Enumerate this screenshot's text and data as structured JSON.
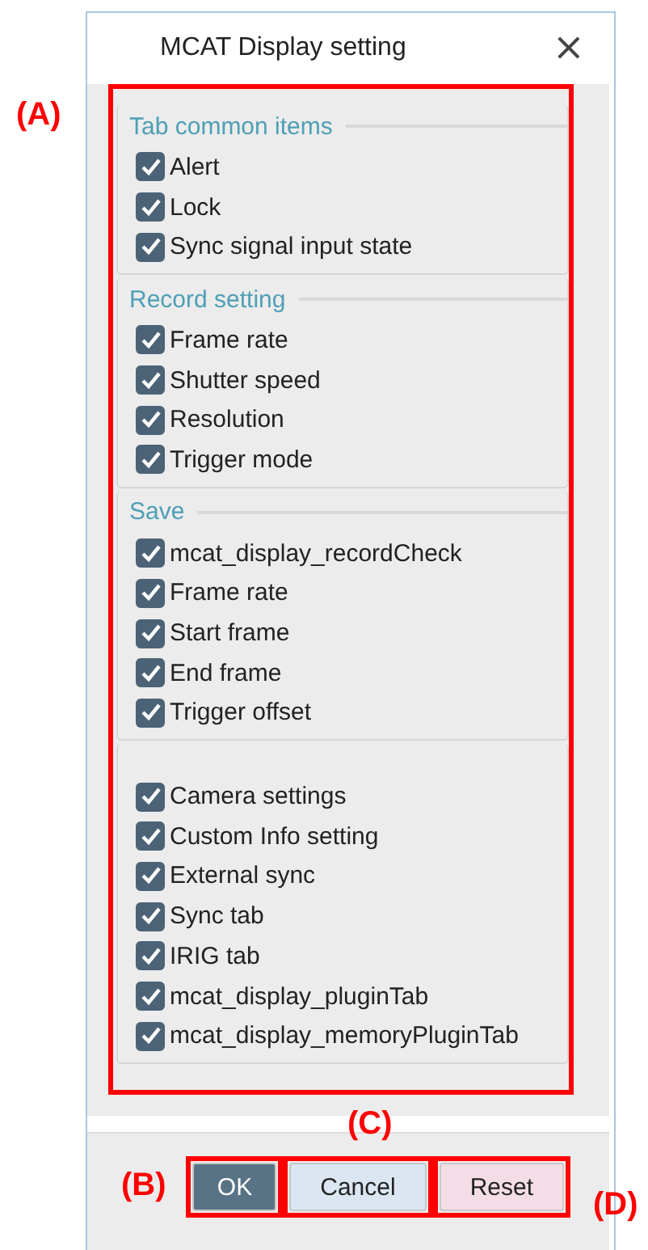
{
  "window": {
    "title": "MCAT Display setting",
    "close": "×"
  },
  "groups": [
    {
      "title": "Tab common items",
      "items": [
        {
          "label": "Alert",
          "checked": true
        },
        {
          "label": "Lock",
          "checked": true
        },
        {
          "label": "Sync signal input state",
          "checked": true
        }
      ]
    },
    {
      "title": "Record setting",
      "items": [
        {
          "label": "Frame rate",
          "checked": true
        },
        {
          "label": "Shutter speed",
          "checked": true
        },
        {
          "label": "Resolution",
          "checked": true
        },
        {
          "label": "Trigger mode",
          "checked": true
        }
      ]
    },
    {
      "title": "Save",
      "items": [
        {
          "label": "mcat_display_recordCheck",
          "checked": true
        },
        {
          "label": "Frame rate",
          "checked": true
        },
        {
          "label": "Start frame",
          "checked": true
        },
        {
          "label": "End frame",
          "checked": true
        },
        {
          "label": "Trigger offset",
          "checked": true
        }
      ]
    },
    {
      "items": [
        {
          "label": "Camera settings",
          "checked": true
        },
        {
          "label": "Custom Info setting",
          "checked": true
        },
        {
          "label": "External sync",
          "checked": true
        },
        {
          "label": "Sync tab",
          "checked": true
        },
        {
          "label": "IRIG tab",
          "checked": true
        },
        {
          "label": "mcat_display_pluginTab",
          "checked": true
        },
        {
          "label": "mcat_display_memoryPluginTab",
          "checked": true
        }
      ]
    }
  ],
  "buttons": [
    {
      "label": "OK",
      "kind": "primary"
    },
    {
      "label": "Cancel",
      "kind": "cancel"
    },
    {
      "label": "Reset",
      "kind": "reset"
    }
  ],
  "annotations": [
    {
      "label": "(A)"
    },
    {
      "label": "(B)"
    },
    {
      "label": "(C)"
    },
    {
      "label": "(D)"
    }
  ]
}
